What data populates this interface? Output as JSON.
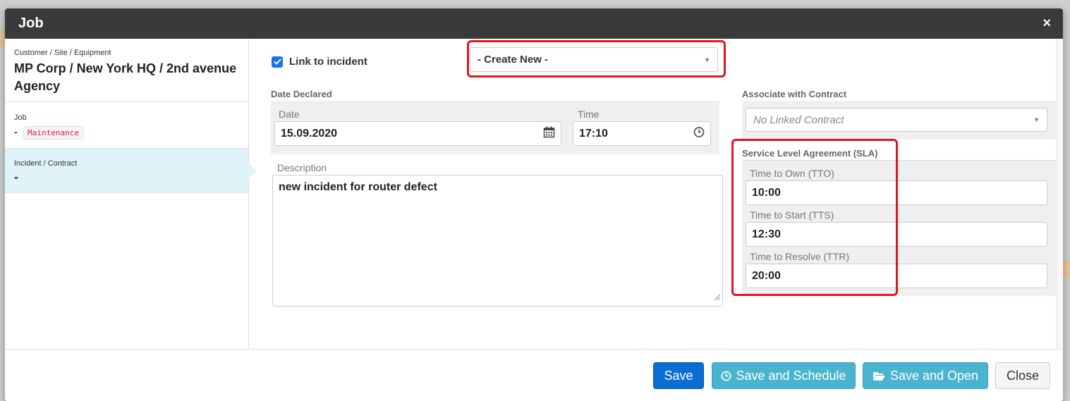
{
  "modal": {
    "title": "Job",
    "close_icon": "×"
  },
  "sidebar": {
    "customer_label": "Customer / Site / Equipment",
    "customer_value": "MP Corp / New York HQ / 2nd avenue Agency",
    "job_label": "Job",
    "job_dash": "-",
    "job_tag": "Maintenance",
    "incident_label": "Incident / Contract",
    "incident_value": "-"
  },
  "form": {
    "link_label": "Link to incident",
    "link_checked": true,
    "incident_select": "- Create New -",
    "date_declared_label": "Date Declared",
    "date_label": "Date",
    "date_value": "15.09.2020",
    "time_label": "Time",
    "time_value": "17:10",
    "description_label": "Description",
    "description_value": "new incident for router defect",
    "contract_label": "Associate with Contract",
    "contract_placeholder": "No Linked Contract",
    "sla_label": "Service Level Agreement (SLA)",
    "tto_label": "Time to Own (TTO)",
    "tto_value": "10:00",
    "tts_label": "Time to Start (TTS)",
    "tts_value": "12:30",
    "ttr_label": "Time to Resolve (TTR)",
    "ttr_value": "20:00"
  },
  "footer": {
    "save": "Save",
    "save_schedule": "Save and Schedule",
    "save_open": "Save and Open",
    "close": "Close"
  },
  "colors": {
    "header": "#3a3a3a",
    "primary": "#0a6ed4",
    "info": "#4ab3cf",
    "highlight": "#e0161f"
  }
}
